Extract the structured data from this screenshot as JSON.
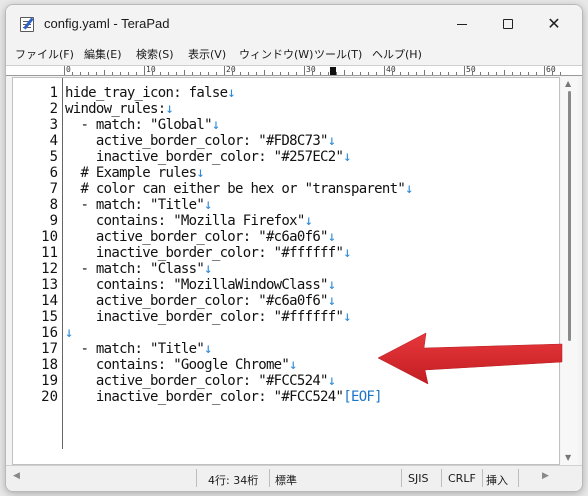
{
  "window": {
    "title": "config.yaml - TeraPad",
    "close_glyph": "✕"
  },
  "menu": [
    "ファイル(F)",
    "編集(E)",
    "検索(S)",
    "表示(V)",
    "ウィンドウ(W)",
    "ツール(T)",
    "ヘルプ(H)"
  ],
  "ruler": {
    "labels": [
      "0",
      "10",
      "20",
      "30",
      "40",
      "50",
      "60"
    ]
  },
  "editor": {
    "lines": [
      {
        "n": "1",
        "text": "hide_tray_icon: false",
        "nl": "↓"
      },
      {
        "n": "2",
        "text": "window_rules:",
        "nl": "↓"
      },
      {
        "n": "3",
        "text": "  - match: \"Global\"",
        "nl": "↓"
      },
      {
        "n": "4",
        "text": "    active_border_color: \"#FD8C73\"",
        "nl": "↓"
      },
      {
        "n": "5",
        "text": "    inactive_border_color: \"#257EC2\"",
        "nl": "↓"
      },
      {
        "n": "6",
        "text": "  # Example rules",
        "nl": "↓"
      },
      {
        "n": "7",
        "text": "  # color can either be hex or \"transparent\"",
        "nl": "↓"
      },
      {
        "n": "8",
        "text": "  - match: \"Title\"",
        "nl": "↓"
      },
      {
        "n": "9",
        "text": "    contains: \"Mozilla Firefox\"",
        "nl": "↓"
      },
      {
        "n": "10",
        "text": "    active_border_color: \"#c6a0f6\"",
        "nl": "↓"
      },
      {
        "n": "11",
        "text": "    inactive_border_color: \"#ffffff\"",
        "nl": "↓"
      },
      {
        "n": "12",
        "text": "  - match: \"Class\"",
        "nl": "↓"
      },
      {
        "n": "13",
        "text": "    contains: \"MozillaWindowClass\"",
        "nl": "↓"
      },
      {
        "n": "14",
        "text": "    active_border_color: \"#c6a0f6\"",
        "nl": "↓"
      },
      {
        "n": "15",
        "text": "    inactive_border_color: \"#ffffff\"",
        "nl": "↓"
      },
      {
        "n": "16",
        "text": "",
        "nl": "↓"
      },
      {
        "n": "17",
        "text": "  - match: \"Title\"",
        "nl": "↓"
      },
      {
        "n": "18",
        "text": "    contains: \"Google Chrome\"",
        "nl": "↓"
      },
      {
        "n": "19",
        "text": "    active_border_color: \"#FCC524\"",
        "nl": "↓"
      },
      {
        "n": "20",
        "text": "    inactive_border_color: \"#FCC524\"",
        "nl": "[EOF]"
      }
    ]
  },
  "status": {
    "position": "4行: 34桁",
    "mode": "標準",
    "encoding": "SJIS",
    "line_ending": "CRLF",
    "insert_mode": "挿入"
  },
  "colors": {
    "newline_mark": "#2a8ad8",
    "annotation_arrow": "#d9262b"
  }
}
